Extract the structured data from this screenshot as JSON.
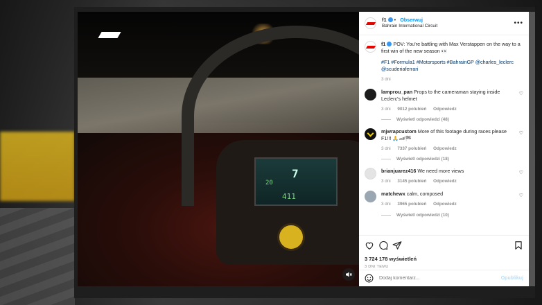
{
  "post": {
    "username": "f1",
    "follow_label": "Obserwuj",
    "location": "Bahrain International Circuit",
    "more_label": "•••"
  },
  "caption": {
    "username": "f1",
    "text": "POV: You're battling with Max Verstappen on the way to a first win of the new season 👀",
    "hashtags": "#F1 #Formula1 #Motorsports #BahrainGP @charles_leclerc @scuderiaferrari",
    "time": "3 dni"
  },
  "comments": [
    {
      "username": "lamprou_pan",
      "text": "Props to the cameraman staying inside Leclerc's helmet",
      "time": "3 dni",
      "likes": "9012 polubień",
      "reply_label": "Odpowiedz",
      "replies_label": "Wyświetl odpowiedzi (48)"
    },
    {
      "username": "mjwrapcustom",
      "text": "More of this footage during races please F1!!! 🙏🏎🏁",
      "time": "3 dni",
      "likes": "7337 polubień",
      "reply_label": "Odpowiedz",
      "replies_label": "Wyświetl odpowiedzi (18)"
    },
    {
      "username": "brianjuarez416",
      "text": "We need more views",
      "time": "3 dni",
      "likes": "3145 polubień",
      "reply_label": "Odpowiedz",
      "replies_label": ""
    },
    {
      "username": "matchewx",
      "text": "calm, composed",
      "time": "3 dni",
      "likes": "3965 polubień",
      "reply_label": "Odpowiedz",
      "replies_label": "Wyświetl odpowiedzi (10)"
    }
  ],
  "engagement": {
    "likes": "3 724 178 wyświetleń",
    "time_ago": "3 DNI TEMU"
  },
  "comment_box": {
    "placeholder": "Dodaj komentarz...",
    "publish_label": "Opublikuj"
  },
  "media": {
    "logo_text": "F1",
    "screen_gear": "7",
    "screen_left": "20",
    "screen_bottom": "411"
  },
  "icons": {
    "like": "heart-icon",
    "comment": "comment-icon",
    "share": "share-icon",
    "save": "bookmark-icon",
    "emoji": "emoji-icon",
    "mute": "mute-icon"
  },
  "colors": {
    "link": "#0095f6",
    "hashtag": "#00376b",
    "f1_red": "#e10600"
  }
}
